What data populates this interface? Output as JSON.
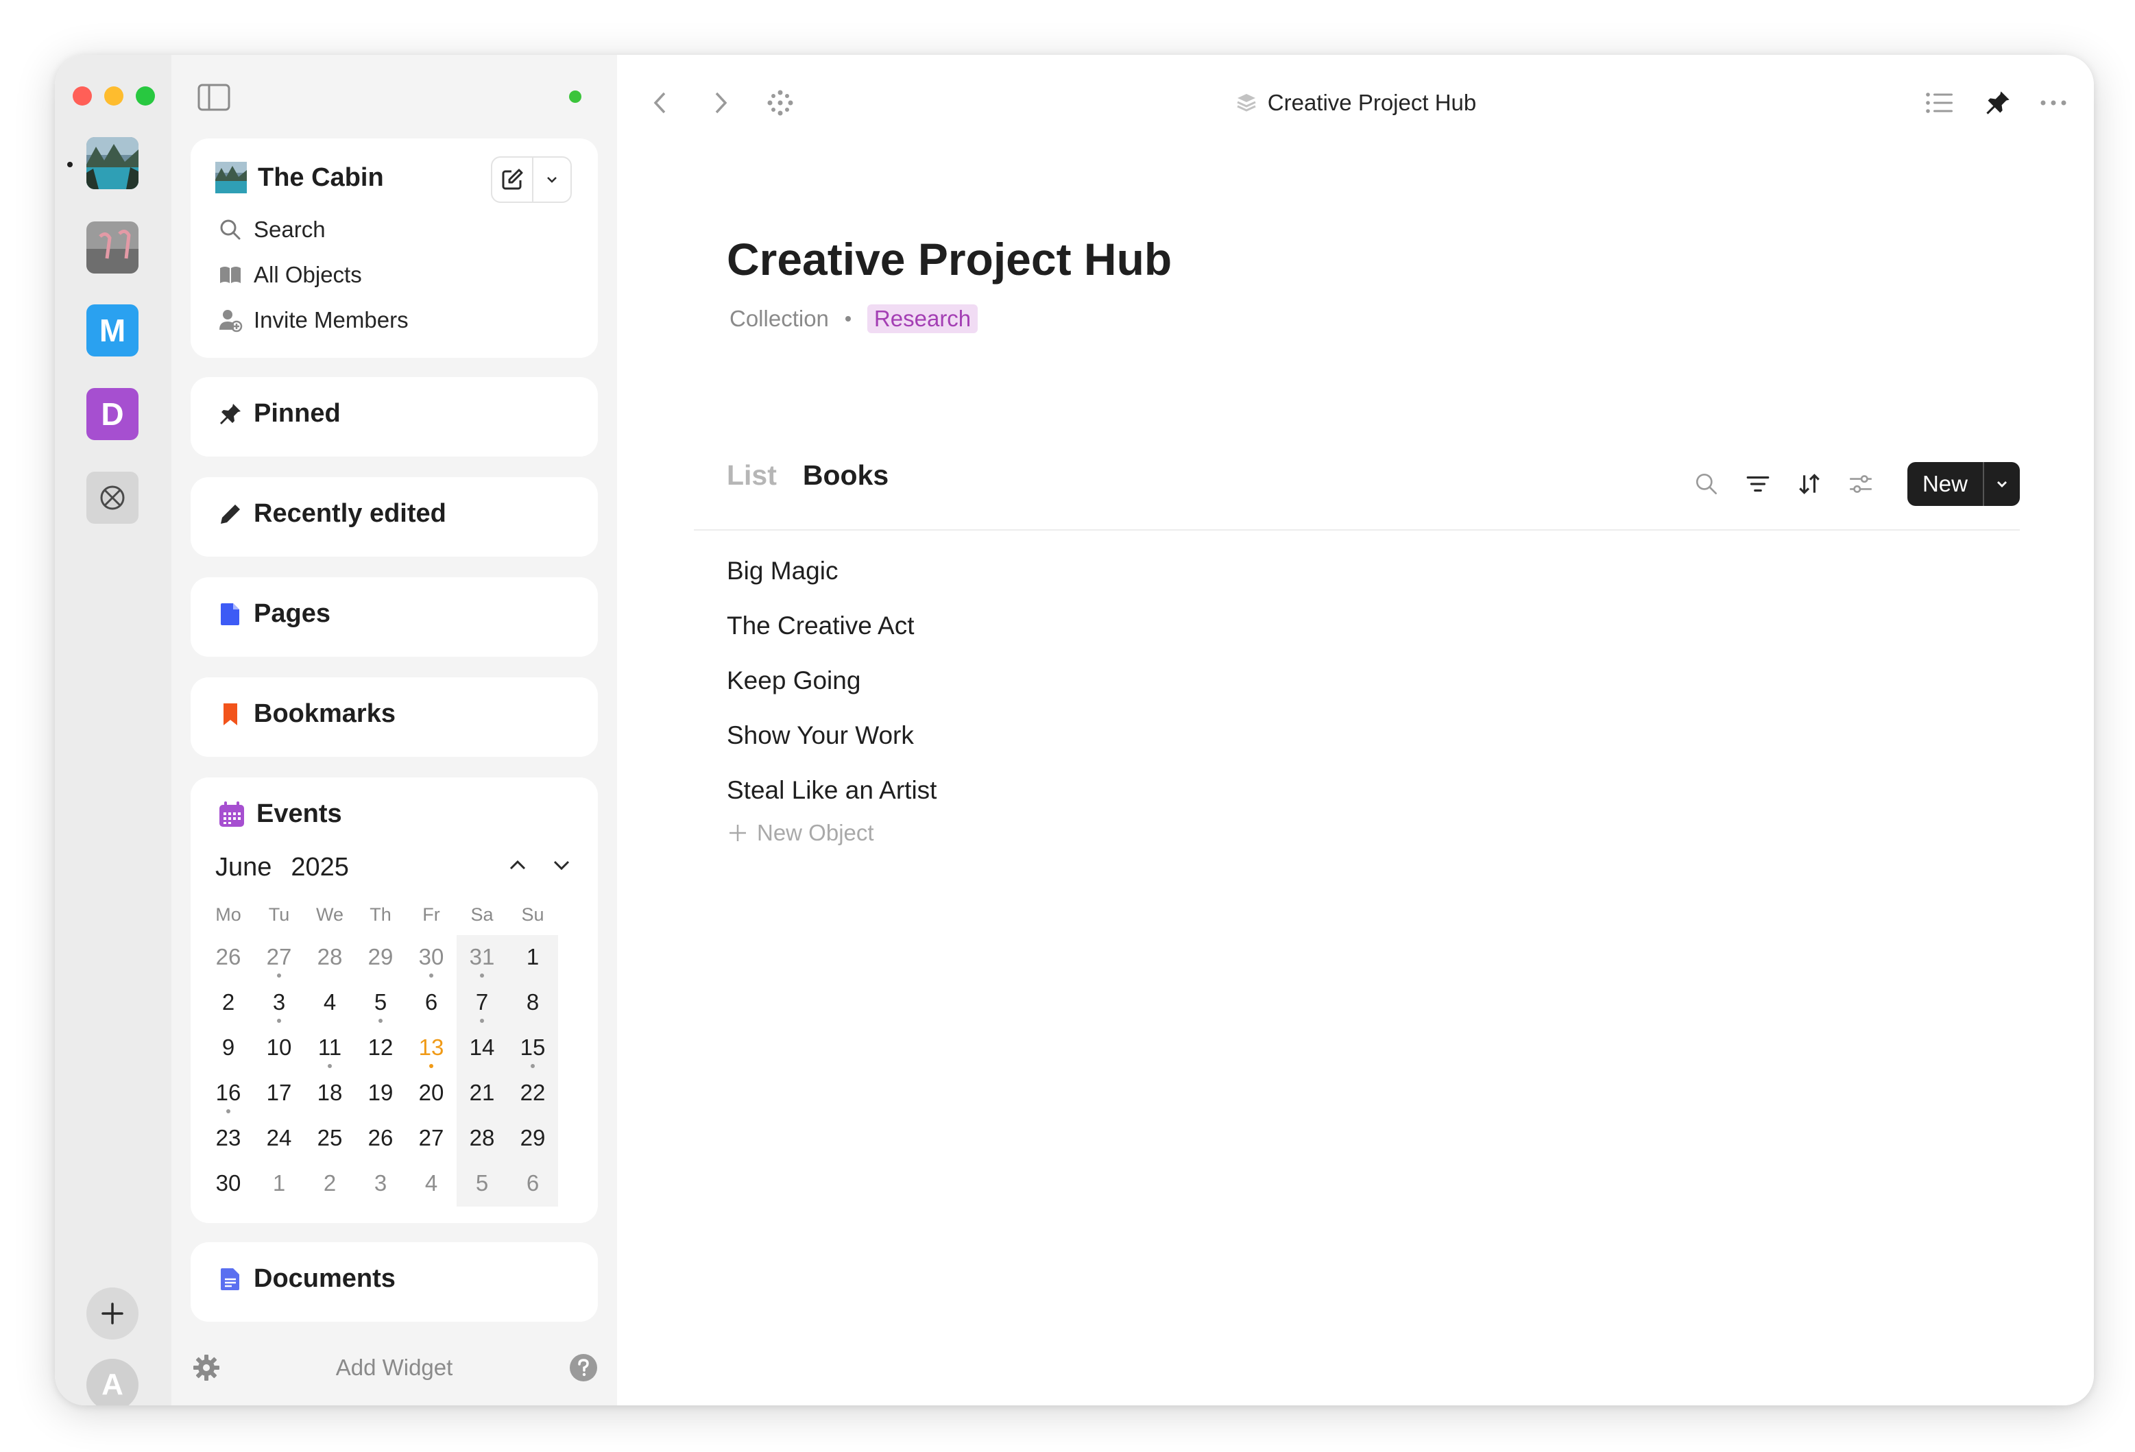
{
  "rail": {
    "spaces": [
      {
        "name": "space-the-cabin",
        "type": "image"
      },
      {
        "name": "space-flamingos",
        "type": "image"
      },
      {
        "name": "space-m",
        "letter": "M",
        "color": "#2aa1f0"
      },
      {
        "name": "space-d",
        "letter": "D",
        "color": "#a64fd0"
      },
      {
        "name": "space-ball",
        "type": "icon"
      }
    ],
    "add_icon": "plus-icon",
    "account_letter": "A"
  },
  "sidebar": {
    "space_name": "The Cabin",
    "menu": [
      {
        "label": "Search",
        "icon": "search-icon"
      },
      {
        "label": "All Objects",
        "icon": "book-icon"
      },
      {
        "label": "Invite Members",
        "icon": "invite-members-icon"
      }
    ],
    "widgets": [
      {
        "label": "Pinned",
        "icon": "pin-icon"
      },
      {
        "label": "Recently edited",
        "icon": "pencil-icon"
      },
      {
        "label": "Pages",
        "icon": "page-icon",
        "color": "#3d5bf5"
      },
      {
        "label": "Bookmarks",
        "icon": "bookmark-icon",
        "color": "#f2541b"
      }
    ],
    "events": {
      "label": "Events",
      "month": "June",
      "year": "2025",
      "weekdays": [
        "Mo",
        "Tu",
        "We",
        "Th",
        "Fr",
        "Sa",
        "Su"
      ],
      "weeks": [
        [
          {
            "d": "26",
            "m": true
          },
          {
            "d": "27",
            "m": true,
            "dot": true
          },
          {
            "d": "28",
            "m": true
          },
          {
            "d": "29",
            "m": true
          },
          {
            "d": "30",
            "m": true,
            "dot": true
          },
          {
            "d": "31",
            "m": true,
            "dot": true
          },
          {
            "d": "1"
          }
        ],
        [
          {
            "d": "2"
          },
          {
            "d": "3",
            "dot": true
          },
          {
            "d": "4"
          },
          {
            "d": "5",
            "dot": true
          },
          {
            "d": "6"
          },
          {
            "d": "7",
            "dot": true
          },
          {
            "d": "8"
          }
        ],
        [
          {
            "d": "9"
          },
          {
            "d": "10"
          },
          {
            "d": "11",
            "dot": true
          },
          {
            "d": "12"
          },
          {
            "d": "13",
            "today": true,
            "dot": true
          },
          {
            "d": "14"
          },
          {
            "d": "15",
            "dot": true
          }
        ],
        [
          {
            "d": "16",
            "dot": true
          },
          {
            "d": "17"
          },
          {
            "d": "18"
          },
          {
            "d": "19"
          },
          {
            "d": "20"
          },
          {
            "d": "21"
          },
          {
            "d": "22"
          }
        ],
        [
          {
            "d": "23"
          },
          {
            "d": "24"
          },
          {
            "d": "25"
          },
          {
            "d": "26"
          },
          {
            "d": "27"
          },
          {
            "d": "28"
          },
          {
            "d": "29"
          }
        ],
        [
          {
            "d": "30"
          },
          {
            "d": "1",
            "m": true
          },
          {
            "d": "2",
            "m": true
          },
          {
            "d": "3",
            "m": true
          },
          {
            "d": "4",
            "m": true
          },
          {
            "d": "5",
            "m": true
          },
          {
            "d": "6",
            "m": true
          }
        ]
      ]
    },
    "documents_label": "Documents",
    "add_widget_label": "Add Widget"
  },
  "topbar": {
    "title": "Creative Project Hub"
  },
  "page": {
    "title": "Creative Project Hub",
    "type": "Collection",
    "tag": "Research",
    "tag_color": "#a43fb4",
    "views": [
      "List",
      "Books"
    ],
    "new_button": "New",
    "objects": [
      "Big Magic",
      "The Creative Act",
      "Keep Going",
      "Show Your Work",
      "Steal Like an Artist"
    ],
    "new_object_label": "New Object"
  }
}
